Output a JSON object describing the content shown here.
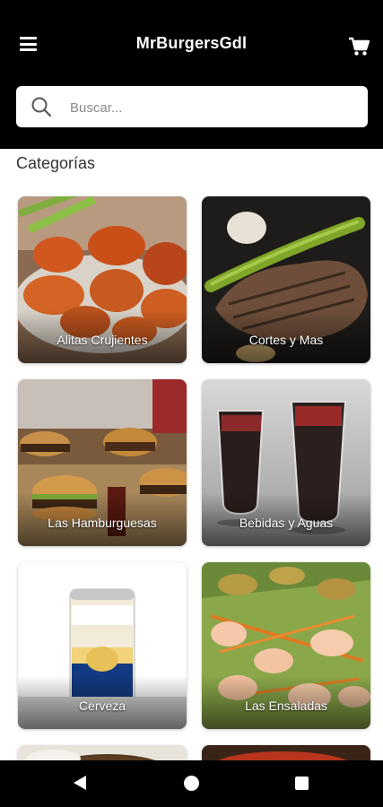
{
  "header": {
    "title": "MrBurgersGdl",
    "menu_icon": "hamburger-menu-icon",
    "cart_icon": "shopping-cart-icon"
  },
  "search": {
    "placeholder": "Buscar...",
    "value": "",
    "icon": "search-icon"
  },
  "categories": {
    "title": "Categorías",
    "items": [
      {
        "label": "Alitas Crujientes"
      },
      {
        "label": "Cortes y Mas"
      },
      {
        "label": "Las Hamburguesas"
      },
      {
        "label": "Bebidas y Aguas"
      },
      {
        "label": "Cerveza"
      },
      {
        "label": "Las Ensaladas"
      }
    ]
  },
  "navbar": {
    "back_icon": "back-triangle-icon",
    "home_icon": "home-circle-icon",
    "recents_icon": "recents-square-icon"
  },
  "colors": {
    "header_bg": "#000000",
    "page_bg": "#ffffff",
    "label_text": "#ffffff"
  }
}
